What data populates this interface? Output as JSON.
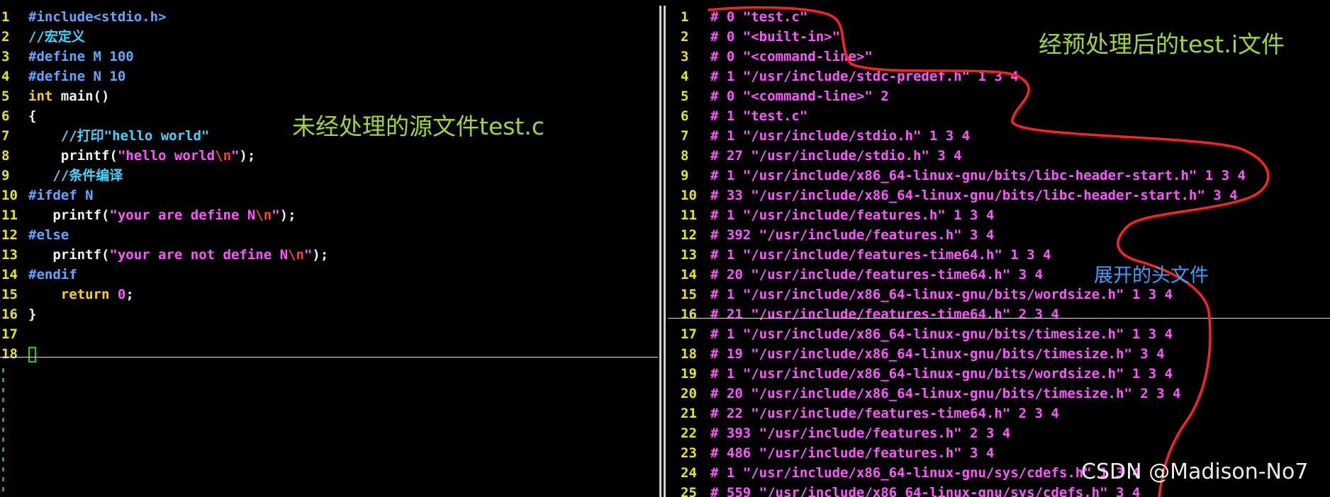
{
  "left_editor": {
    "lines": [
      {
        "n": "1",
        "segs": [
          {
            "t": "#include<stdio.h>",
            "c": "c-pre"
          }
        ]
      },
      {
        "n": "2",
        "segs": [
          {
            "t": "//宏定义",
            "c": "c-cmt"
          }
        ]
      },
      {
        "n": "3",
        "segs": [
          {
            "t": "#define M 100",
            "c": "c-pre"
          }
        ]
      },
      {
        "n": "4",
        "segs": [
          {
            "t": "#define N 10",
            "c": "c-pre"
          }
        ]
      },
      {
        "n": "5",
        "segs": [
          {
            "t": "int",
            "c": "c-kw"
          },
          {
            "t": " main()",
            "c": "c-plain"
          }
        ]
      },
      {
        "n": "6",
        "segs": [
          {
            "t": "{",
            "c": "c-plain"
          }
        ]
      },
      {
        "n": "7",
        "segs": [
          {
            "t": "    //打印\"hello world\"",
            "c": "c-cmt"
          }
        ]
      },
      {
        "n": "8",
        "segs": [
          {
            "t": "    printf(",
            "c": "c-plain"
          },
          {
            "t": "\"hello world",
            "c": "c-str"
          },
          {
            "t": "\\n",
            "c": "c-esc"
          },
          {
            "t": "\"",
            "c": "c-str"
          },
          {
            "t": ");",
            "c": "c-plain"
          }
        ]
      },
      {
        "n": "9",
        "segs": [
          {
            "t": "   //条件编译",
            "c": "c-cmt"
          }
        ]
      },
      {
        "n": "10",
        "segs": [
          {
            "t": "#ifdef N",
            "c": "c-pre"
          }
        ]
      },
      {
        "n": "11",
        "segs": [
          {
            "t": "   printf(",
            "c": "c-plain"
          },
          {
            "t": "\"your are define N",
            "c": "c-str"
          },
          {
            "t": "\\n",
            "c": "c-esc"
          },
          {
            "t": "\"",
            "c": "c-str"
          },
          {
            "t": ");",
            "c": "c-plain"
          }
        ]
      },
      {
        "n": "12",
        "segs": [
          {
            "t": "#else",
            "c": "c-pre"
          }
        ]
      },
      {
        "n": "13",
        "segs": [
          {
            "t": "   printf(",
            "c": "c-plain"
          },
          {
            "t": "\"your are not define N",
            "c": "c-str"
          },
          {
            "t": "\\n",
            "c": "c-esc"
          },
          {
            "t": "\"",
            "c": "c-str"
          },
          {
            "t": ");",
            "c": "c-plain"
          }
        ]
      },
      {
        "n": "14",
        "segs": [
          {
            "t": "#endif",
            "c": "c-pre"
          }
        ]
      },
      {
        "n": "15",
        "segs": [
          {
            "t": "    ",
            "c": "c-plain"
          },
          {
            "t": "return",
            "c": "c-kw"
          },
          {
            "t": " ",
            "c": "c-plain"
          },
          {
            "t": "0",
            "c": "c-str"
          },
          {
            "t": ";",
            "c": "c-plain"
          }
        ]
      },
      {
        "n": "16",
        "segs": [
          {
            "t": "}",
            "c": "c-plain"
          }
        ]
      },
      {
        "n": "17",
        "segs": []
      },
      {
        "n": "18",
        "segs": [],
        "cursor": true
      }
    ]
  },
  "right_editor": {
    "lines": [
      {
        "n": "1",
        "text": "# 0 \"test.c\""
      },
      {
        "n": "2",
        "text": "# 0 \"<built-in>\""
      },
      {
        "n": "3",
        "text": "# 0 \"<command-line>\""
      },
      {
        "n": "4",
        "text": "# 1 \"/usr/include/stdc-predef.h\" 1 3 4"
      },
      {
        "n": "5",
        "text": "# 0 \"<command-line>\" 2"
      },
      {
        "n": "6",
        "text": "# 1 \"test.c\""
      },
      {
        "n": "7",
        "text": "# 1 \"/usr/include/stdio.h\" 1 3 4"
      },
      {
        "n": "8",
        "text": "# 27 \"/usr/include/stdio.h\" 3 4"
      },
      {
        "n": "9",
        "text": "# 1 \"/usr/include/x86_64-linux-gnu/bits/libc-header-start.h\" 1 3 4"
      },
      {
        "n": "10",
        "text": "# 33 \"/usr/include/x86_64-linux-gnu/bits/libc-header-start.h\" 3 4"
      },
      {
        "n": "11",
        "text": "# 1 \"/usr/include/features.h\" 1 3 4"
      },
      {
        "n": "12",
        "text": "# 392 \"/usr/include/features.h\" 3 4"
      },
      {
        "n": "13",
        "text": "# 1 \"/usr/include/features-time64.h\" 1 3 4"
      },
      {
        "n": "14",
        "text": "# 20 \"/usr/include/features-time64.h\" 3 4"
      },
      {
        "n": "15",
        "text": "# 1 \"/usr/include/x86_64-linux-gnu/bits/wordsize.h\" 1 3 4"
      },
      {
        "n": "16",
        "text": "# 21 \"/usr/include/features-time64.h\" 2 3 4"
      },
      {
        "n": "17",
        "text": "# 1 \"/usr/include/x86_64-linux-gnu/bits/timesize.h\" 1 3 4"
      },
      {
        "n": "18",
        "text": "# 19 \"/usr/include/x86_64-linux-gnu/bits/timesize.h\" 3 4"
      },
      {
        "n": "19",
        "text": "# 1 \"/usr/include/x86_64-linux-gnu/bits/wordsize.h\" 1 3 4"
      },
      {
        "n": "20",
        "text": "# 20 \"/usr/include/x86_64-linux-gnu/bits/timesize.h\" 2 3 4"
      },
      {
        "n": "21",
        "text": "# 22 \"/usr/include/features-time64.h\" 2 3 4"
      },
      {
        "n": "22",
        "text": "# 393 \"/usr/include/features.h\" 2 3 4"
      },
      {
        "n": "23",
        "text": "# 486 \"/usr/include/features.h\" 3 4"
      },
      {
        "n": "24",
        "text": "# 1 \"/usr/include/x86_64-linux-gnu/sys/cdefs.h\" 1 3 4"
      },
      {
        "n": "25",
        "text": "# 559 \"/usr/include/x86_64-linux-gnu/sys/cdefs.h\" 3 4"
      }
    ]
  },
  "annotations": {
    "left_label": "未经处理的源文件test.c",
    "right_label": "经预处理后的test.i文件",
    "headers_label": "展开的头文件",
    "watermark": "CSDN @Madison-No7"
  },
  "colors": {
    "line_number": "#e8e800",
    "preprocessor": "#5fa8ff",
    "comment": "#3fd7ff",
    "string": "#ff55ff",
    "keyword": "#ffd300",
    "escape": "#ff3b3b",
    "annotation_green": "#9ed92a",
    "annotation_blue": "#3aa0ff",
    "red_curve": "#ff2020"
  }
}
